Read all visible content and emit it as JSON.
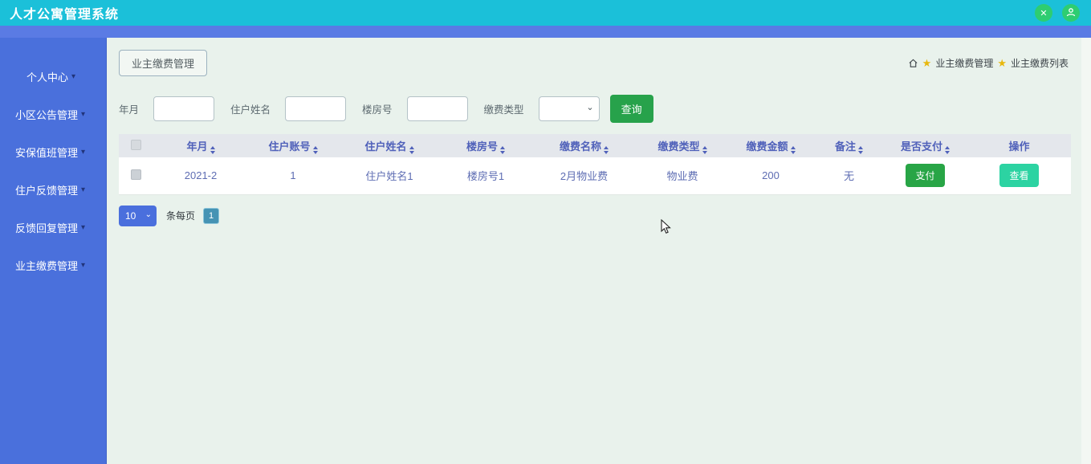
{
  "header": {
    "title": "人才公寓管理系统",
    "close_icon": "✕"
  },
  "sidebar": {
    "items": [
      {
        "label": "个人中心"
      },
      {
        "label": "小区公告管理"
      },
      {
        "label": "安保值班管理"
      },
      {
        "label": "住户反馈管理"
      },
      {
        "label": "反馈回复管理"
      },
      {
        "label": "业主缴费管理"
      }
    ],
    "caret": "▾"
  },
  "main": {
    "tab_label": "业主缴费管理",
    "breadcrumb": {
      "star": "★",
      "item1": "业主缴费管理",
      "item2": "业主缴费列表"
    },
    "search": {
      "field1_label": "年月",
      "field2_label": "住户姓名",
      "field3_label": "楼房号",
      "select_label": "缴费类型",
      "select_chevron": "⌄",
      "query_label": "查询"
    },
    "table": {
      "headers": [
        "年月",
        "住户账号",
        "住户姓名",
        "楼房号",
        "缴费名称",
        "缴费类型",
        "缴费金额",
        "备注",
        "是否支付",
        "操作"
      ],
      "rows": [
        {
          "year_month": "2021-2",
          "account": "1",
          "resident_name": "住户姓名1",
          "building_no": "楼房号1",
          "fee_name": "2月物业费",
          "fee_type": "物业费",
          "amount": "200",
          "remark": "无",
          "pay_label": "支付",
          "view_label": "查看"
        }
      ]
    },
    "pagination": {
      "page_size": "10",
      "chevron": "⌄",
      "per_page_label": "条每页",
      "page": "1"
    }
  },
  "colors": {
    "topbar": "#1bc0d9",
    "subbar": "#5a7be4",
    "sidebar": "#4a70dc",
    "content_bg": "#e9f2ec",
    "table_header_bg": "#e4e7ec",
    "header_text": "#5061ba",
    "cell_text": "#5e6db3",
    "query_green": "#27a24b",
    "pay_green": "#28a546",
    "view_mint": "#2cd3a2",
    "circle_green": "#2ecd71",
    "pager_blue": "#4a6fdd",
    "page_btn_blue": "#4593b4",
    "star_gold": "#e8b80e"
  }
}
